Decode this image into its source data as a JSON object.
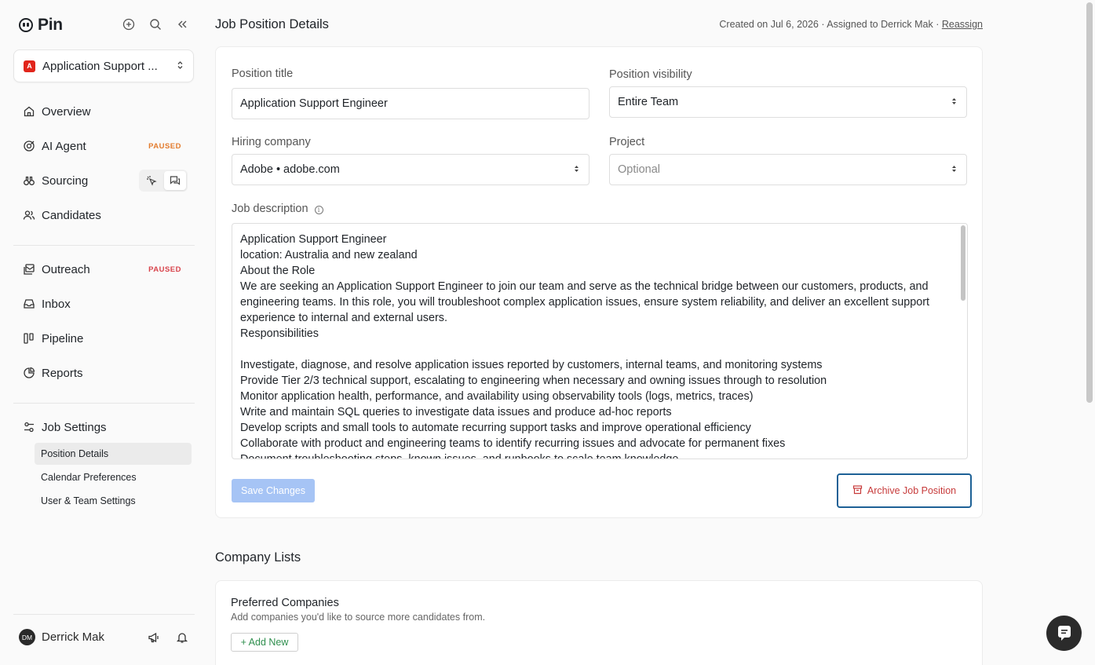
{
  "app": {
    "name": "Pin"
  },
  "job_select": {
    "label": "Application Support ...",
    "logo_text": "A"
  },
  "nav": {
    "overview": "Overview",
    "ai_agent": "AI Agent",
    "ai_agent_badge": "PAUSED",
    "sourcing": "Sourcing",
    "candidates": "Candidates",
    "outreach": "Outreach",
    "outreach_badge": "PAUSED",
    "inbox": "Inbox",
    "pipeline": "Pipeline",
    "reports": "Reports",
    "job_settings": "Job Settings",
    "sub": [
      "Position Details",
      "Calendar Preferences",
      "User & Team Settings"
    ]
  },
  "user": {
    "initials": "DM",
    "name": "Derrick Mak"
  },
  "header": {
    "title": "Job Position Details",
    "meta": "Created on Jul 6, 2026 · Assigned to Derrick Mak · ",
    "reassign": "Reassign"
  },
  "form": {
    "position_title_label": "Position title",
    "position_title_value": "Application Support Engineer",
    "visibility_label": "Position visibility",
    "visibility_value": "Entire Team",
    "hiring_company_label": "Hiring company",
    "hiring_company_value": "Adobe • adobe.com",
    "project_label": "Project",
    "project_placeholder": "Optional",
    "description_label": "Job description",
    "description_value": "Application Support Engineer\nlocation: Australia and new zealand\nAbout the Role\nWe are seeking an Application Support Engineer to join our team and serve as the technical bridge between our customers, products, and engineering teams. In this role, you will troubleshoot complex application issues, ensure system reliability, and deliver an excellent support experience to internal and external users.\nResponsibilities\n\nInvestigate, diagnose, and resolve application issues reported by customers, internal teams, and monitoring systems\nProvide Tier 2/3 technical support, escalating to engineering when necessary and owning issues through to resolution\nMonitor application health, performance, and availability using observability tools (logs, metrics, traces)\nWrite and maintain SQL queries to investigate data issues and produce ad-hoc reports\nDevelop scripts and small tools to automate recurring support tasks and improve operational efficiency\nCollaborate with product and engineering teams to identify recurring issues and advocate for permanent fixes\nDocument troubleshooting steps, known issues, and runbooks to scale team knowledge",
    "save_label": "Save Changes",
    "archive_label": "Archive Job Position"
  },
  "company_lists": {
    "section_title": "Company Lists",
    "preferred_title": "Preferred Companies",
    "preferred_desc": "Add companies you'd like to source more candidates from.",
    "add_label": "+ Add New"
  },
  "colors": {
    "accent": "#1d6196",
    "save_disabled": "#a6c4f5",
    "danger": "#c73b3b",
    "paused_orange": "#e37c2e",
    "paused_red": "#d8434b",
    "add_green": "#2f8f4e"
  }
}
